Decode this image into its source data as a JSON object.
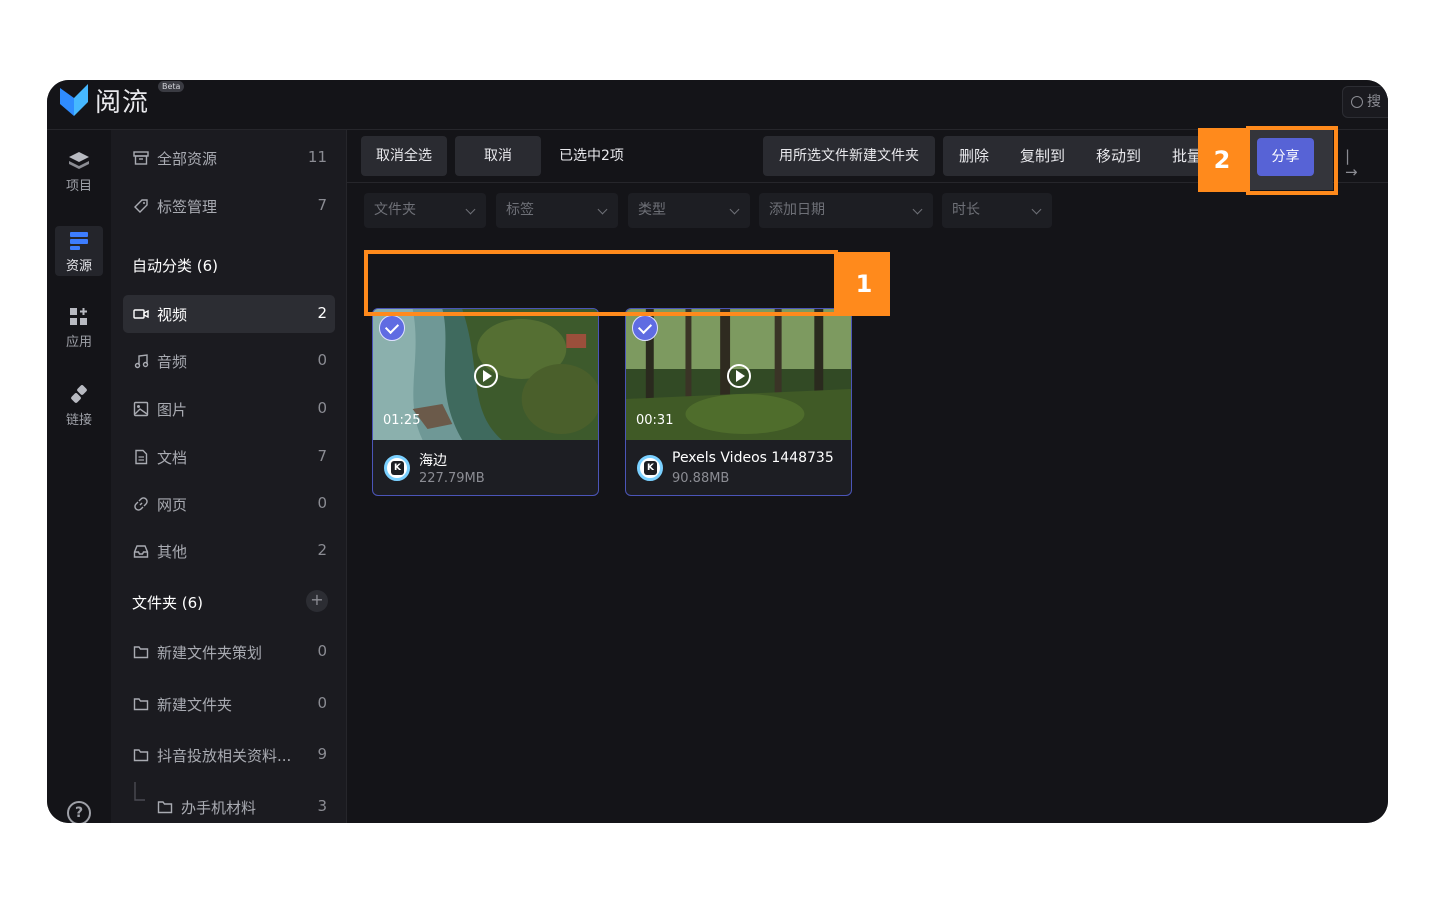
{
  "app": {
    "name": "阅流",
    "badge": "Beta",
    "search_placeholder": "搜"
  },
  "rail": [
    {
      "label": "项目",
      "icon": "layers-icon"
    },
    {
      "label": "资源",
      "icon": "resources-icon",
      "active": true
    },
    {
      "label": "应用",
      "icon": "apps-icon"
    },
    {
      "label": "链接",
      "icon": "link-icon"
    }
  ],
  "sidebar": {
    "all": {
      "label": "全部资源",
      "count": "11"
    },
    "tags": {
      "label": "标签管理",
      "count": "7"
    },
    "auto_heading": "自动分类 (6)",
    "categories": [
      {
        "label": "视频",
        "count": "2",
        "icon": "video-icon",
        "active": true
      },
      {
        "label": "音频",
        "count": "0",
        "icon": "music-icon"
      },
      {
        "label": "图片",
        "count": "0",
        "icon": "image-icon"
      },
      {
        "label": "文档",
        "count": "7",
        "icon": "document-icon"
      },
      {
        "label": "网页",
        "count": "0",
        "icon": "link-icon"
      },
      {
        "label": "其他",
        "count": "2",
        "icon": "inbox-icon"
      }
    ],
    "folder_heading": "文件夹 (6)",
    "add_folder_symbol": "+",
    "folders": [
      {
        "label": "新建文件夹策划",
        "count": "0"
      },
      {
        "label": "新建文件夹",
        "count": "0"
      },
      {
        "label": "抖音投放相关资料...",
        "count": "9"
      },
      {
        "label": "办手机材料",
        "count": "3"
      }
    ]
  },
  "toolbar": {
    "deselect_all": "取消全选",
    "cancel": "取消",
    "selected_status": "已选中2项",
    "new_folder_from_selection": "用所选文件新建文件夹",
    "delete": "删除",
    "copy_to": "复制到",
    "move_to": "移动到",
    "batch": "批量",
    "share": "分享",
    "collapse_symbol": "|→"
  },
  "filters": [
    {
      "label": "文件夹"
    },
    {
      "label": "标签"
    },
    {
      "label": "类型"
    },
    {
      "label": "添加日期"
    },
    {
      "label": "时长"
    }
  ],
  "cards": [
    {
      "name": "海边",
      "size": "227.79MB",
      "duration": "01:25",
      "selected": true,
      "app_letter": "K"
    },
    {
      "name": "Pexels Videos 1448735",
      "size": "90.88MB",
      "duration": "00:31",
      "selected": true,
      "app_letter": "K"
    }
  ],
  "annotations": [
    {
      "label": "1"
    },
    {
      "label": "2"
    }
  ],
  "help_symbol": "?",
  "colors": {
    "accent": "#5763d6",
    "annotation": "#ff8a1c",
    "background": "#141418",
    "sidebar": "#1b1b20"
  }
}
